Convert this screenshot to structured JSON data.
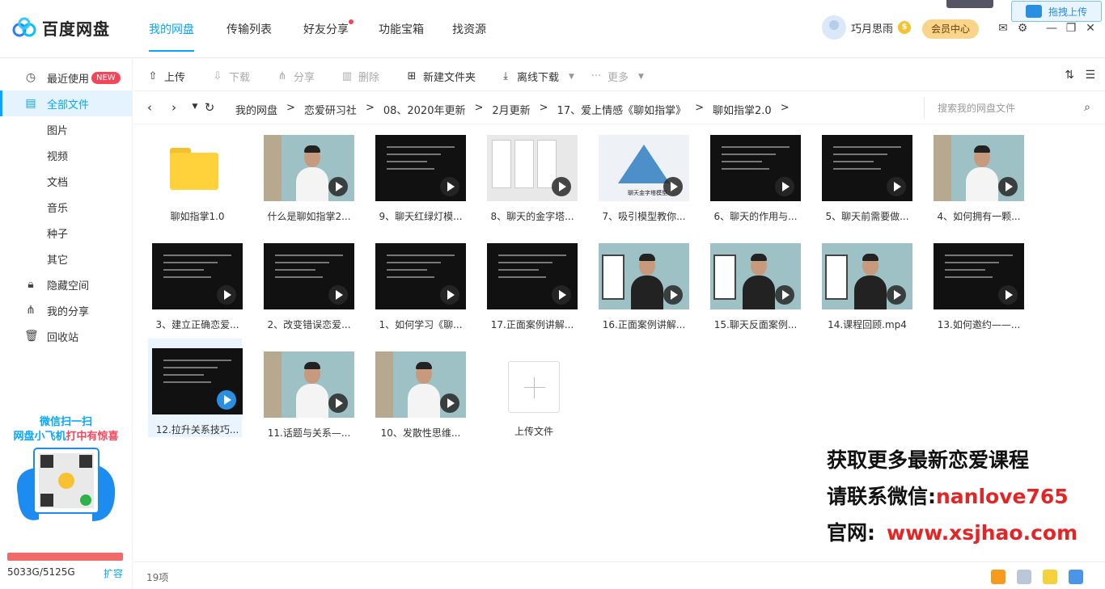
{
  "app": {
    "name": "百度网盘"
  },
  "nav": {
    "tabs": [
      "我的网盘",
      "传输列表",
      "好友分享",
      "功能宝箱",
      "找资源"
    ],
    "active_index": 0
  },
  "user": {
    "name": "巧月思雨",
    "vip_label": "会员中心",
    "drag_upload": "拖拽上传"
  },
  "sidebar": {
    "items": [
      {
        "label": "最近使用",
        "icon": "clock-icon",
        "badge": "NEW"
      },
      {
        "label": "全部文件",
        "icon": "file-icon",
        "active": true
      },
      {
        "label": "图片"
      },
      {
        "label": "视频"
      },
      {
        "label": "文档"
      },
      {
        "label": "音乐"
      },
      {
        "label": "种子"
      },
      {
        "label": "其它"
      },
      {
        "label": "隐藏空间",
        "icon": "lock-icon"
      },
      {
        "label": "我的分享",
        "icon": "share-icon"
      },
      {
        "label": "回收站",
        "icon": "trash-icon"
      }
    ],
    "promo_line1": "微信扫一扫",
    "promo_line2a": "网盘小飞机",
    "promo_line2b": "打中有惊喜",
    "quota": "5033G/5125G",
    "quota_fraction": 0.982,
    "expand": "扩容"
  },
  "toolbar": {
    "upload": "上传",
    "download": "下载",
    "share": "分享",
    "delete": "删除",
    "new_folder": "新建文件夹",
    "offline_download": "离线下载",
    "more": "更多"
  },
  "path": {
    "crumbs": [
      "我的网盘",
      "恋爱研习社",
      "08、2020年更新",
      "2月更新",
      "17、爱上情感《聊如指掌》",
      "聊如指掌2.0"
    ],
    "search_placeholder": "搜索我的网盘文件"
  },
  "files": [
    {
      "name": "聊如指掌1.0",
      "kind": "folder"
    },
    {
      "name": "什么是聊如指掌2...",
      "kind": "person"
    },
    {
      "name": "9、聊天红绿灯模...",
      "kind": "slide"
    },
    {
      "name": "8、聊天的金字塔...",
      "kind": "chat"
    },
    {
      "name": "7、吸引模型教你...",
      "kind": "pyramid"
    },
    {
      "name": "6、聊天的作用与...",
      "kind": "slide"
    },
    {
      "name": "5、聊天前需要做...",
      "kind": "slide"
    },
    {
      "name": "4、如何拥有一颗...",
      "kind": "person"
    },
    {
      "name": "3、建立正确恋爱...",
      "kind": "slide"
    },
    {
      "name": "2、改变错误恋爱...",
      "kind": "slide"
    },
    {
      "name": "1、如何学习《聊...",
      "kind": "slide"
    },
    {
      "name": "17.正面案例讲解...",
      "kind": "slide"
    },
    {
      "name": "16.正面案例讲解...",
      "kind": "person-phone"
    },
    {
      "name": "15.聊天反面案例...",
      "kind": "person-phone"
    },
    {
      "name": "14.课程回顾.mp4",
      "kind": "person-phone"
    },
    {
      "name": "13.如何邀约——...",
      "kind": "slide"
    },
    {
      "name": "12.拉升关系技巧...",
      "kind": "slide",
      "selected": true
    },
    {
      "name": "11.话题与关系—...",
      "kind": "person"
    },
    {
      "name": "10、发散性思维...",
      "kind": "person"
    }
  ],
  "upload_tile": "上传文件",
  "watermark": {
    "line1": "获取更多最新恋爱课程",
    "line2_prefix": "请联系微信:",
    "line2_value": "nanlove765",
    "line3_prefix": "官网:",
    "line3_value": "www.xsjhao.com"
  },
  "status": {
    "count": "19项"
  },
  "pyramid_caption": "聊天金字塔模型",
  "colors": {
    "accent": "#06a7ff",
    "badge": "#f5455b",
    "folder": "#ffd23c",
    "quota_bar": "#f16a6a"
  }
}
